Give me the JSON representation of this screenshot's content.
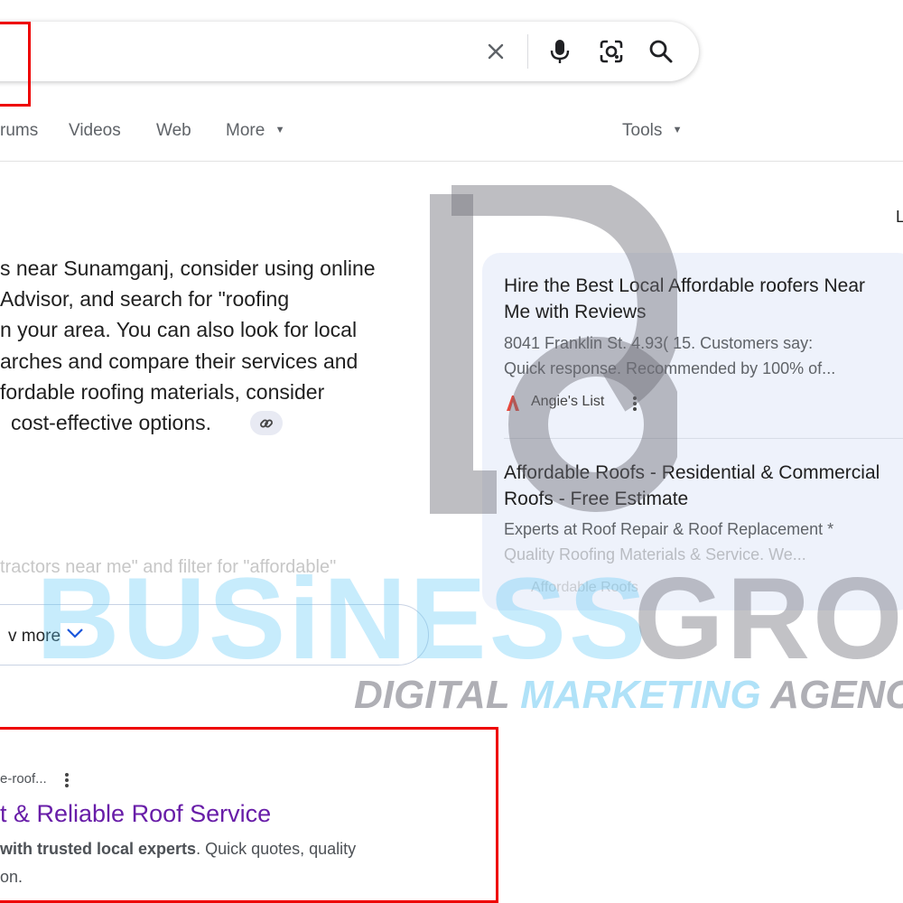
{
  "search": {
    "query": "",
    "clear_icon": "close-icon",
    "voice_icon": "mic-icon",
    "lens_icon": "camera-lens-icon",
    "search_icon": "search-icon"
  },
  "tabs": [
    {
      "label": "rums"
    },
    {
      "label": "Videos"
    },
    {
      "label": "Web"
    },
    {
      "label": "More"
    }
  ],
  "tools_label": "Tools",
  "ai_overview": {
    "lines": [
      "s near Sunamganj, consider using online",
      "Advisor, and search for \"roofing",
      "n your area. You can also look for local",
      "arches and compare their services and",
      "fordable roofing materials, consider",
      "cost-effective options."
    ],
    "faded_line": "tractors near me\" and filter for \"affordable\"",
    "show_more": "v more"
  },
  "side_letter": "L",
  "sources": [
    {
      "title": "Hire the Best Local Affordable roofers Near Me with Reviews",
      "desc_1": "8041 Franklin St. 4.93( 15. Customers say:",
      "desc_2": "Quick response. Recommended by 100% of...",
      "source": "Angie's List"
    },
    {
      "title": "Affordable Roofs - Residential & Commercial Roofs - Free Estimate",
      "desc_1": "Experts at Roof Repair & Roof Replacement *",
      "desc_2": "Quality Roofing Materials & Service. We...",
      "source": "Affordable Roofs"
    }
  ],
  "watermark": {
    "word_1": "BUSiNESS",
    "word_2": "GROW",
    "tag_1": "DIGITAL ",
    "tag_2": "MARKETING ",
    "tag_3": "AGENC"
  },
  "result": {
    "url": "e-roof...",
    "title": "t & Reliable Roof Service",
    "snippet_bold": "with trusted local experts",
    "snippet_rest": ". Quick quotes, quality",
    "snippet_2": "on."
  },
  "colors": {
    "highlight_red": "#e00000",
    "visited_link": "#681da8"
  }
}
